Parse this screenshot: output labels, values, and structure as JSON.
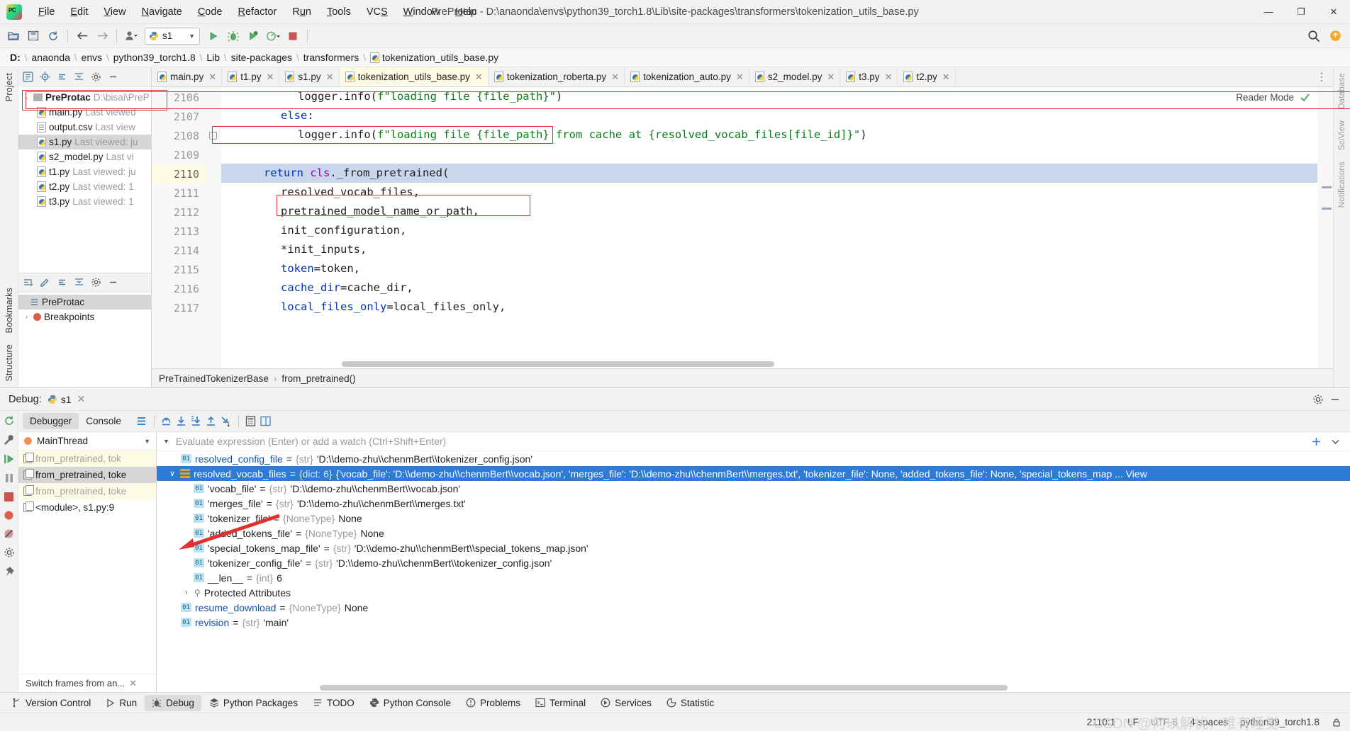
{
  "window": {
    "title": "PreProtac - D:\\anaonda\\envs\\python39_torch1.8\\Lib\\site-packages\\transformers\\tokenization_utils_base.py",
    "minimize": "—",
    "maximize": "❐",
    "close": "✕"
  },
  "menu": [
    "File",
    "Edit",
    "View",
    "Navigate",
    "Code",
    "Refactor",
    "Run",
    "Tools",
    "VCS",
    "Window",
    "Help"
  ],
  "toolbar": {
    "run_config": "s1",
    "icons": [
      "open-folder-icon",
      "save-icon",
      "sync-icon",
      "back-icon",
      "forward-icon",
      "user-icon",
      "run-icon",
      "debug-icon",
      "coverage-icon",
      "profile-icon",
      "stop-icon",
      "search-icon",
      "updates-icon"
    ]
  },
  "breadcrumb": [
    "D:",
    "anaonda",
    "envs",
    "python39_torch1.8",
    "Lib",
    "site-packages",
    "transformers",
    "tokenization_utils_base.py"
  ],
  "project": {
    "panel_label": "Project",
    "root": {
      "name": "PreProtac",
      "meta": "D:\\bisai\\PreP"
    },
    "files": [
      {
        "name": "main.py",
        "meta": "Last viewed",
        "icon": "python-file-icon",
        "selected": false
      },
      {
        "name": "output.csv",
        "meta": "Last view",
        "icon": "csv-file-icon",
        "selected": false
      },
      {
        "name": "s1.py",
        "meta": "Last viewed: ju",
        "icon": "python-file-icon",
        "selected": true
      },
      {
        "name": "s2_model.py",
        "meta": "Last vi",
        "icon": "python-file-icon",
        "selected": false
      },
      {
        "name": "t1.py",
        "meta": "Last viewed: ju",
        "icon": "python-file-icon",
        "selected": false
      },
      {
        "name": "t2.py",
        "meta": "Last viewed: 1",
        "icon": "python-file-icon",
        "selected": false
      },
      {
        "name": "t3.py",
        "meta": "Last viewed: 1",
        "icon": "python-file-icon",
        "selected": false
      }
    ],
    "structure": [
      {
        "name": "PreProtac",
        "icon": "list-icon",
        "selected": true
      },
      {
        "name": "Breakpoints",
        "icon": "breakpoint-icon",
        "selected": false
      }
    ]
  },
  "tabs": [
    {
      "label": "main.py",
      "active": false
    },
    {
      "label": "t1.py",
      "active": false
    },
    {
      "label": "s1.py",
      "active": false
    },
    {
      "label": "tokenization_utils_base.py",
      "active": true
    },
    {
      "label": "tokenization_roberta.py",
      "active": false
    },
    {
      "label": "tokenization_auto.py",
      "active": false
    },
    {
      "label": "s2_model.py",
      "active": false
    },
    {
      "label": "t3.py",
      "active": false
    },
    {
      "label": "t2.py",
      "active": false
    }
  ],
  "editor": {
    "reader_mode": "Reader Mode",
    "line_numbers": [
      "2106",
      "2107",
      "2108",
      "2109",
      "2110",
      "2111",
      "2112",
      "2113",
      "2114",
      "2115",
      "2116",
      "2117"
    ],
    "lines": [
      {
        "n": "2106",
        "indent": 16,
        "tokens": [
          {
            "t": "logger.info(",
            "c": "param"
          },
          {
            "t": "f\"loading file {file_path}\"",
            "c": "str"
          },
          {
            "t": ")",
            "c": "param"
          }
        ]
      },
      {
        "n": "2107",
        "indent": 12,
        "tokens": [
          {
            "t": "else",
            "c": "kw"
          },
          {
            "t": ":",
            "c": "param"
          }
        ]
      },
      {
        "n": "2108",
        "indent": 16,
        "tokens": [
          {
            "t": "logger.info(",
            "c": "param"
          },
          {
            "t": "f\"loading file {file_path} from cache at {resolved_vocab_files[file_id]}\"",
            "c": "str"
          },
          {
            "t": ")",
            "c": "param"
          }
        ]
      },
      {
        "n": "2109",
        "indent": 0,
        "tokens": []
      },
      {
        "n": "2110",
        "indent": 8,
        "highlight": true,
        "tokens": [
          {
            "t": "return ",
            "c": "kw"
          },
          {
            "t": "cls",
            "c": "cls"
          },
          {
            "t": "._from_pretrained(",
            "c": "param"
          }
        ]
      },
      {
        "n": "2111",
        "indent": 12,
        "tokens": [
          {
            "t": "resolved_vocab_files,",
            "c": "param"
          }
        ]
      },
      {
        "n": "2112",
        "indent": 12,
        "tokens": [
          {
            "t": "pretrained_model_name_or_path,",
            "c": "param"
          }
        ]
      },
      {
        "n": "2113",
        "indent": 12,
        "tokens": [
          {
            "t": "init_configuration,",
            "c": "param"
          }
        ]
      },
      {
        "n": "2114",
        "indent": 12,
        "tokens": [
          {
            "t": "*init_inputs,",
            "c": "param"
          }
        ]
      },
      {
        "n": "2115",
        "indent": 12,
        "tokens": [
          {
            "t": "token",
            "c": "kw"
          },
          {
            "t": "=token,",
            "c": "param"
          }
        ]
      },
      {
        "n": "2116",
        "indent": 12,
        "tokens": [
          {
            "t": "cache_dir",
            "c": "kw"
          },
          {
            "t": "=cache_dir,",
            "c": "param"
          }
        ]
      },
      {
        "n": "2117",
        "indent": 12,
        "tokens": [
          {
            "t": "local_files_only",
            "c": "kw"
          },
          {
            "t": "=local_files_only,",
            "c": "param"
          }
        ]
      }
    ],
    "footer_breadcrumb": [
      "PreTrainedTokenizerBase",
      "from_pretrained()"
    ]
  },
  "debug": {
    "title": "Debug:",
    "config": "s1",
    "tabs": [
      {
        "label": "Debugger",
        "active": true
      },
      {
        "label": "Console",
        "active": false
      }
    ],
    "thread": "MainThread",
    "frames": [
      {
        "label": "from_pretrained, tok",
        "state": "lib"
      },
      {
        "label": "from_pretrained, toke",
        "state": "sel"
      },
      {
        "label": "from_pretrained, toke",
        "state": "lib"
      },
      {
        "label": "<module>, s1.py:9",
        "state": "normal"
      }
    ],
    "switch_frames": "Switch frames from an...",
    "evaluate_placeholder": "Evaluate expression (Enter) or add a watch (Ctrl+Shift+Enter)",
    "variables": [
      {
        "indent": 0,
        "icon": "int-badge",
        "name": "resolved_config_file",
        "eq": " = ",
        "type": "{str}",
        "value": "'D:\\\\demo-zhu\\\\chenmBert\\\\tokenizer_config.json'",
        "selected": false
      },
      {
        "indent": 0,
        "icon": "dict-icon",
        "twist": "∨",
        "name": "resolved_vocab_files",
        "eq": " = ",
        "type": "{dict: 6}",
        "value": "{'vocab_file': 'D:\\\\demo-zhu\\\\chenmBert\\\\vocab.json', 'merges_file': 'D:\\\\demo-zhu\\\\chenmBert\\\\merges.txt', 'tokenizer_file': None, 'added_tokens_file': None, 'special_tokens_map ... View",
        "selected": true
      },
      {
        "indent": 1,
        "icon": "int-badge",
        "name": "'vocab_file'",
        "eq": " = ",
        "type": "{str}",
        "value": "'D:\\\\demo-zhu\\\\chenmBert\\\\vocab.json'",
        "selected": false
      },
      {
        "indent": 1,
        "icon": "int-badge",
        "name": "'merges_file'",
        "eq": " = ",
        "type": "{str}",
        "value": "'D:\\\\demo-zhu\\\\chenmBert\\\\merges.txt'",
        "selected": false
      },
      {
        "indent": 1,
        "icon": "int-badge",
        "name": "'tokenizer_file'",
        "eq": " = ",
        "type": "{NoneType}",
        "value": "None",
        "selected": false
      },
      {
        "indent": 1,
        "icon": "int-badge",
        "name": "'added_tokens_file'",
        "eq": " = ",
        "type": "{NoneType}",
        "value": "None",
        "selected": false
      },
      {
        "indent": 1,
        "icon": "int-badge",
        "name": "'special_tokens_map_file'",
        "eq": " = ",
        "type": "{str}",
        "value": "'D:\\\\demo-zhu\\\\chenmBert\\\\special_tokens_map.json'",
        "selected": false
      },
      {
        "indent": 1,
        "icon": "int-badge",
        "name": "'tokenizer_config_file'",
        "eq": " = ",
        "type": "{str}",
        "value": "'D:\\\\demo-zhu\\\\chenmBert\\\\tokenizer_config.json'",
        "selected": false
      },
      {
        "indent": 1,
        "icon": "int-badge",
        "name": "__len__",
        "eq": " = ",
        "type": "{int}",
        "value": "6",
        "selected": false
      },
      {
        "indent": 1,
        "icon": "protected-icon",
        "twist": "›",
        "name": "Protected Attributes",
        "eq": "",
        "type": "",
        "value": "",
        "selected": false,
        "plain": true
      },
      {
        "indent": 0,
        "icon": "int-badge",
        "name": "resume_download",
        "eq": " = ",
        "type": "{NoneType}",
        "value": "None",
        "selected": false
      },
      {
        "indent": 0,
        "icon": "int-badge",
        "name": "revision",
        "eq": " = ",
        "type": "{str}",
        "value": "'main'",
        "selected": false
      }
    ]
  },
  "toolwindows": [
    {
      "label": "Version Control",
      "icon": "branch-icon",
      "active": false
    },
    {
      "label": "Run",
      "icon": "run-icon",
      "active": false
    },
    {
      "label": "Debug",
      "icon": "debug-icon",
      "active": true
    },
    {
      "label": "Python Packages",
      "icon": "packages-icon",
      "active": false
    },
    {
      "label": "TODO",
      "icon": "todo-icon",
      "active": false
    },
    {
      "label": "Python Console",
      "icon": "python-icon",
      "active": false
    },
    {
      "label": "Problems",
      "icon": "problems-icon",
      "active": false
    },
    {
      "label": "Terminal",
      "icon": "terminal-icon",
      "active": false
    },
    {
      "label": "Services",
      "icon": "services-icon",
      "active": false
    },
    {
      "label": "Statistic",
      "icon": "statistic-icon",
      "active": false
    }
  ],
  "statusbar": {
    "caret": "2110:1",
    "line_sep": "LF",
    "encoding": "UTF-8",
    "indent": "4 spaces",
    "interpreter": "python39_torch1.8",
    "watermark": "CSDN @何以解忧，唯有睡觉"
  },
  "sidebars": {
    "left_top": "Project",
    "left_bottom": [
      "Bookmarks",
      "Structure"
    ],
    "right": [
      "Database",
      "SciView",
      "Notifications"
    ]
  },
  "colors": {
    "accent": "#2d7bd4",
    "annotation": "#e03030",
    "keyword": "#0033b3",
    "string": "#067d17",
    "class": "#871094",
    "highlight": "#c9d6ec"
  }
}
